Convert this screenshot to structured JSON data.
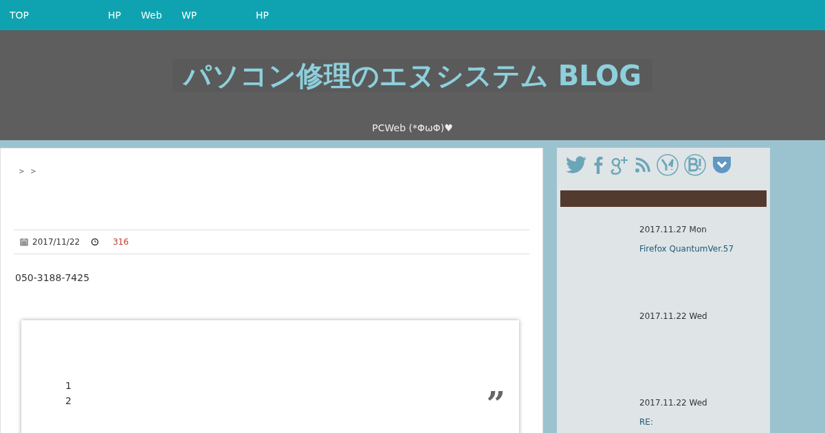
{
  "nav": [
    {
      "label": "TOP"
    },
    {
      "label": "HP"
    },
    {
      "label": "Web"
    },
    {
      "label": "WP"
    },
    {
      "label": "HP"
    }
  ],
  "header": {
    "title": "パソコン修理のエヌシステム BLOG",
    "subtitle": "PCWeb (*ΦωΦ)♥"
  },
  "article": {
    "breadcrumb": "＞ ＞",
    "date": "2017/11/22",
    "views": "316",
    "phone": "050-3188-7425",
    "quote": {
      "lines": [
        "1",
        "2"
      ],
      "mark": "”"
    }
  },
  "sidebar": {
    "social": [
      {
        "kind": "twitter"
      },
      {
        "kind": "facebook"
      },
      {
        "kind": "gplus"
      },
      {
        "kind": "rss"
      },
      {
        "kind": "yahoo"
      },
      {
        "kind": "hatena"
      },
      {
        "kind": "pocket"
      }
    ],
    "posts": [
      {
        "date": "2017.11.27 Mon",
        "title": "Firefox QuantumVer.57"
      },
      {
        "date": "2017.11.22 Wed"
      },
      {
        "date": "2017.11.22 Wed",
        "title": "RE:"
      }
    ]
  }
}
